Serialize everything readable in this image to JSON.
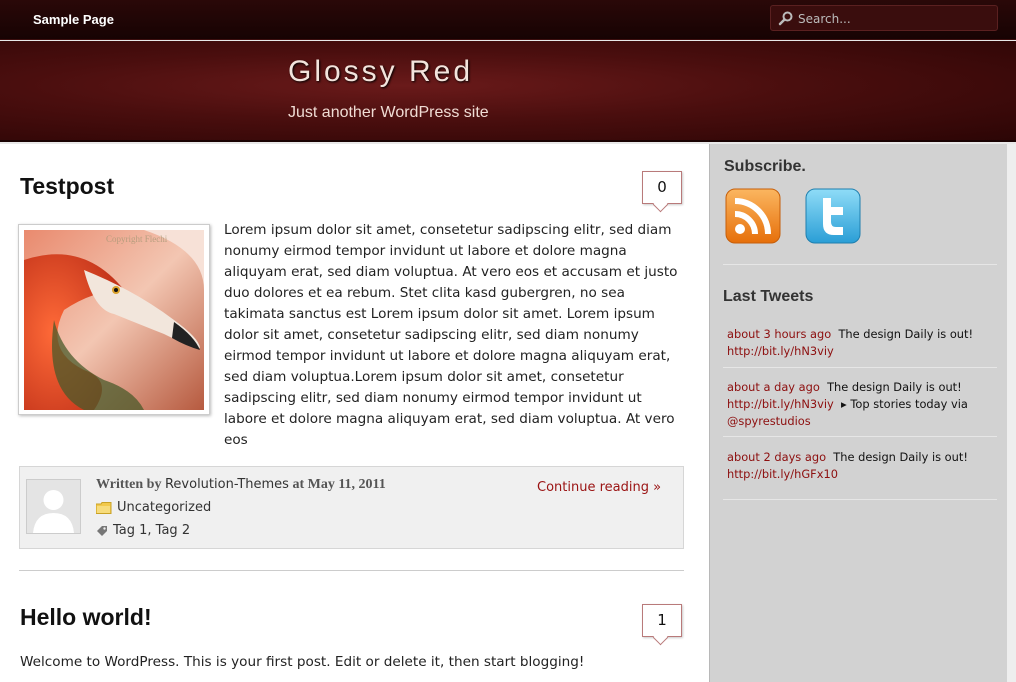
{
  "nav": {
    "sample_page": "Sample Page"
  },
  "search": {
    "placeholder": "Search..."
  },
  "header": {
    "title": "Glossy Red",
    "description": "Just another WordPress site"
  },
  "posts": [
    {
      "title": "Testpost",
      "comments": "0",
      "image_watermark": "Copyright Flechi",
      "body": "Lorem ipsum dolor sit amet, consetetur sadipscing elitr, sed diam nonumy eirmod tempor invidunt ut labore et dolore magna aliquyam erat, sed diam voluptua. At vero eos et accusam et justo duo dolores et ea rebum. Stet clita kasd gubergren, no sea takimata sanctus est Lorem ipsum dolor sit amet. Lorem ipsum dolor sit amet, consetetur sadipscing elitr, sed diam nonumy eirmod tempor invidunt ut labore et dolore magna aliquyam erat, sed diam voluptua.Lorem ipsum dolor sit amet, consetetur sadipscing elitr, sed diam nonumy eirmod tempor invidunt ut labore et dolore magna aliquyam erat, sed diam voluptua. At vero eos",
      "meta": {
        "written_by": "Written by",
        "author": "Revolution-Themes",
        "at": "at May 11, 2011",
        "category": "Uncategorized",
        "tags": "Tag 1, Tag 2",
        "continue": "Continue reading »"
      }
    },
    {
      "title": "Hello world!",
      "comments": "1",
      "body": "Welcome to WordPress. This is your first post. Edit or delete it, then start blogging!"
    }
  ],
  "sidebar": {
    "subscribe_title": "Subscribe.",
    "tweets_title": "Last Tweets",
    "tweets": [
      {
        "time": "about 3 hours ago",
        "text": "The design Daily is out!",
        "link": "http://bit.ly/hN3viy",
        "extra": "",
        "extra_link": ""
      },
      {
        "time": "about a day ago",
        "text": "The design Daily is out!",
        "link": "http://bit.ly/hN3viy",
        "extra": "▸ Top stories today via",
        "extra_link": "@spyrestudios"
      },
      {
        "time": "about 2 days ago",
        "text": "The design Daily is out!",
        "link": "http://bit.ly/hGFx10",
        "extra": "",
        "extra_link": ""
      }
    ]
  },
  "colors": {
    "accent_red": "#8d0f0f",
    "header_dark": "#2c0505",
    "sidebar_bg": "#d2d2d2"
  },
  "icons": [
    "search-icon",
    "rss-icon",
    "twitter-icon",
    "folder-icon",
    "tag-icon",
    "avatar-placeholder-icon"
  ]
}
